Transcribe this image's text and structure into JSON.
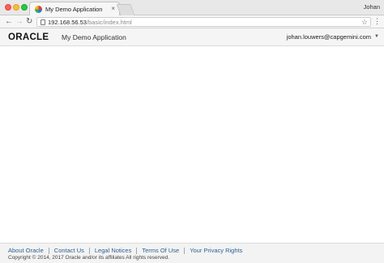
{
  "browser": {
    "tab": {
      "title": "My Demo Application",
      "close_glyph": "×"
    },
    "profile_name": "Johan",
    "nav": {
      "back_glyph": "←",
      "forward_glyph": "→",
      "reload_glyph": "↻"
    },
    "address": {
      "host": "192.168.56.53",
      "path": "/basic/index.html"
    },
    "icons": {
      "bookmark": "star-icon",
      "menu": "menu-icon"
    },
    "bookmark_glyph": "☆",
    "menu_glyph": "⋮"
  },
  "app_header": {
    "logo_text": "ORACLE",
    "title": "My Demo Application",
    "user_email": "johan.louwers@capgemini.com",
    "caret_glyph": "▼"
  },
  "footer": {
    "links": [
      {
        "label": "About Oracle"
      },
      {
        "label": "Contact Us"
      },
      {
        "label": "Legal Notices"
      },
      {
        "label": "Terms Of Use"
      },
      {
        "label": "Your Privacy Rights"
      }
    ],
    "copyright": "Copyright © 2014, 2017 Oracle and/or its affiliates All rights reserved."
  },
  "colors": {
    "link": "#2c5f93",
    "header_bg": "#f5f5f5",
    "footer_bg": "#f3f3f3"
  }
}
